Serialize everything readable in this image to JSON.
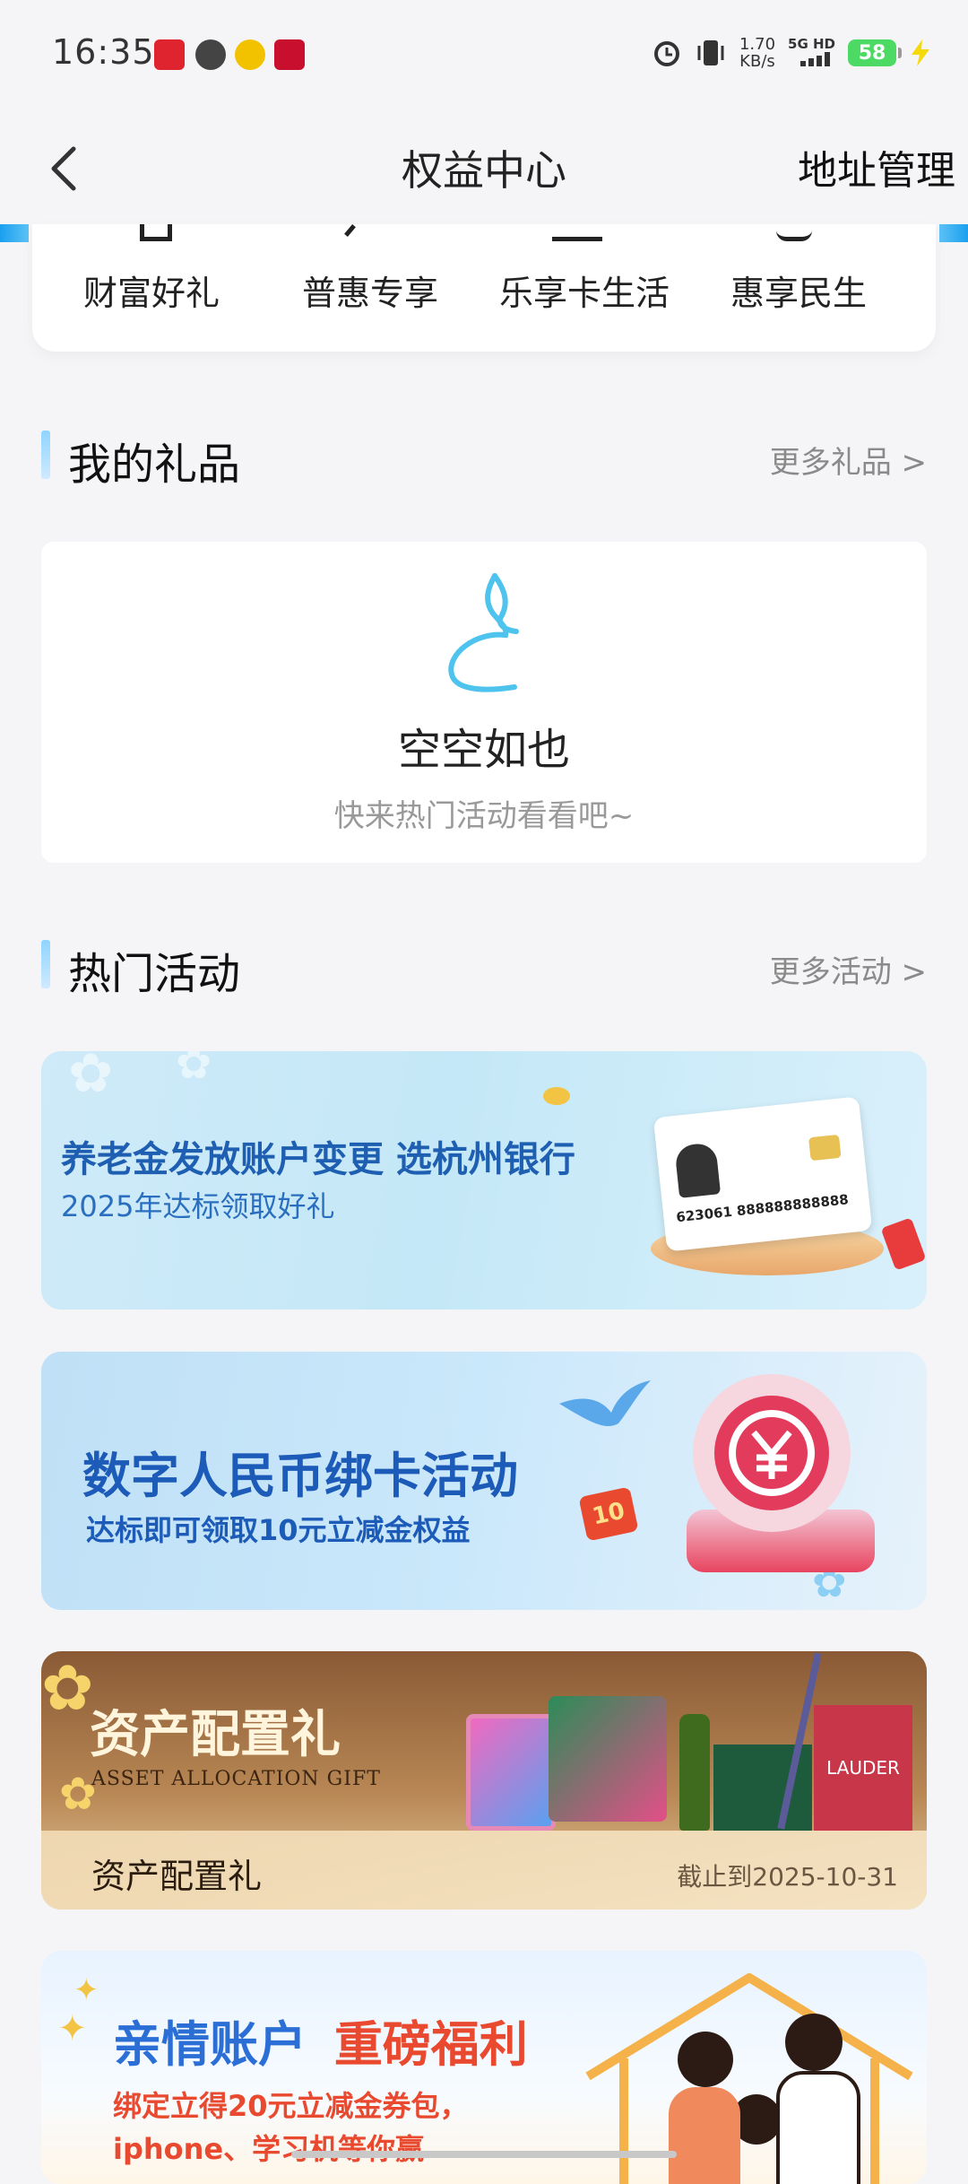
{
  "status_bar": {
    "time": "16:35",
    "speed_value": "1.70",
    "speed_unit": "KB/s",
    "network": "5G HD",
    "battery": "58",
    "notification_icons": [
      "app-notification-icon",
      "message-icon",
      "coin-icon",
      "bank-app-icon"
    ],
    "right_icons": [
      "alarm-icon",
      "vibrate-icon",
      "signal-icon",
      "battery-icon",
      "charging-icon"
    ]
  },
  "navbar": {
    "title": "权益中心",
    "right_action": "地址管理"
  },
  "categories": [
    {
      "label": "财富好礼"
    },
    {
      "label": "普惠专享"
    },
    {
      "label": "乐享卡生活"
    },
    {
      "label": "惠享民生"
    }
  ],
  "my_gifts": {
    "title": "我的礼品",
    "more": "更多礼品 >",
    "empty_title": "空空如也",
    "empty_subtitle": "快来热门活动看看吧~"
  },
  "hot_activities": {
    "title": "热门活动",
    "more": "更多活动 >",
    "banners": [
      {
        "title": "养老金发放账户变更  选杭州银行",
        "subtitle": "2025年达标领取好礼",
        "card_number": "623061 888888888888",
        "colors": {
          "title": "#1f5fb2",
          "subtitle": "#2a6fbf"
        }
      },
      {
        "title": "数字人民币绑卡活动",
        "subtitle": "达标即可领取10元立减金权益",
        "badge": "10",
        "colors": {
          "title": "#1d5bb8",
          "subtitle": "#1d5bb8",
          "coin": "#e23b5c"
        }
      },
      {
        "title": "资产配置礼",
        "title_en": "ASSET ALLOCATION GIFT",
        "footer_label": "资产配置礼",
        "deadline": "截止到2025-10-31",
        "product_text": "LAUDER",
        "colors": {
          "title": "#fff4dc"
        }
      },
      {
        "title_part1": "亲情账户",
        "title_part2": "重磅福利",
        "subtitle_line1": "绑定立得20元立减金券包，",
        "subtitle_line2": "iphone、学习机等你赢",
        "colors": {
          "part1": "#2b6fd6",
          "part2": "#e8492f",
          "subtitle": "#e8492f"
        }
      }
    ]
  }
}
